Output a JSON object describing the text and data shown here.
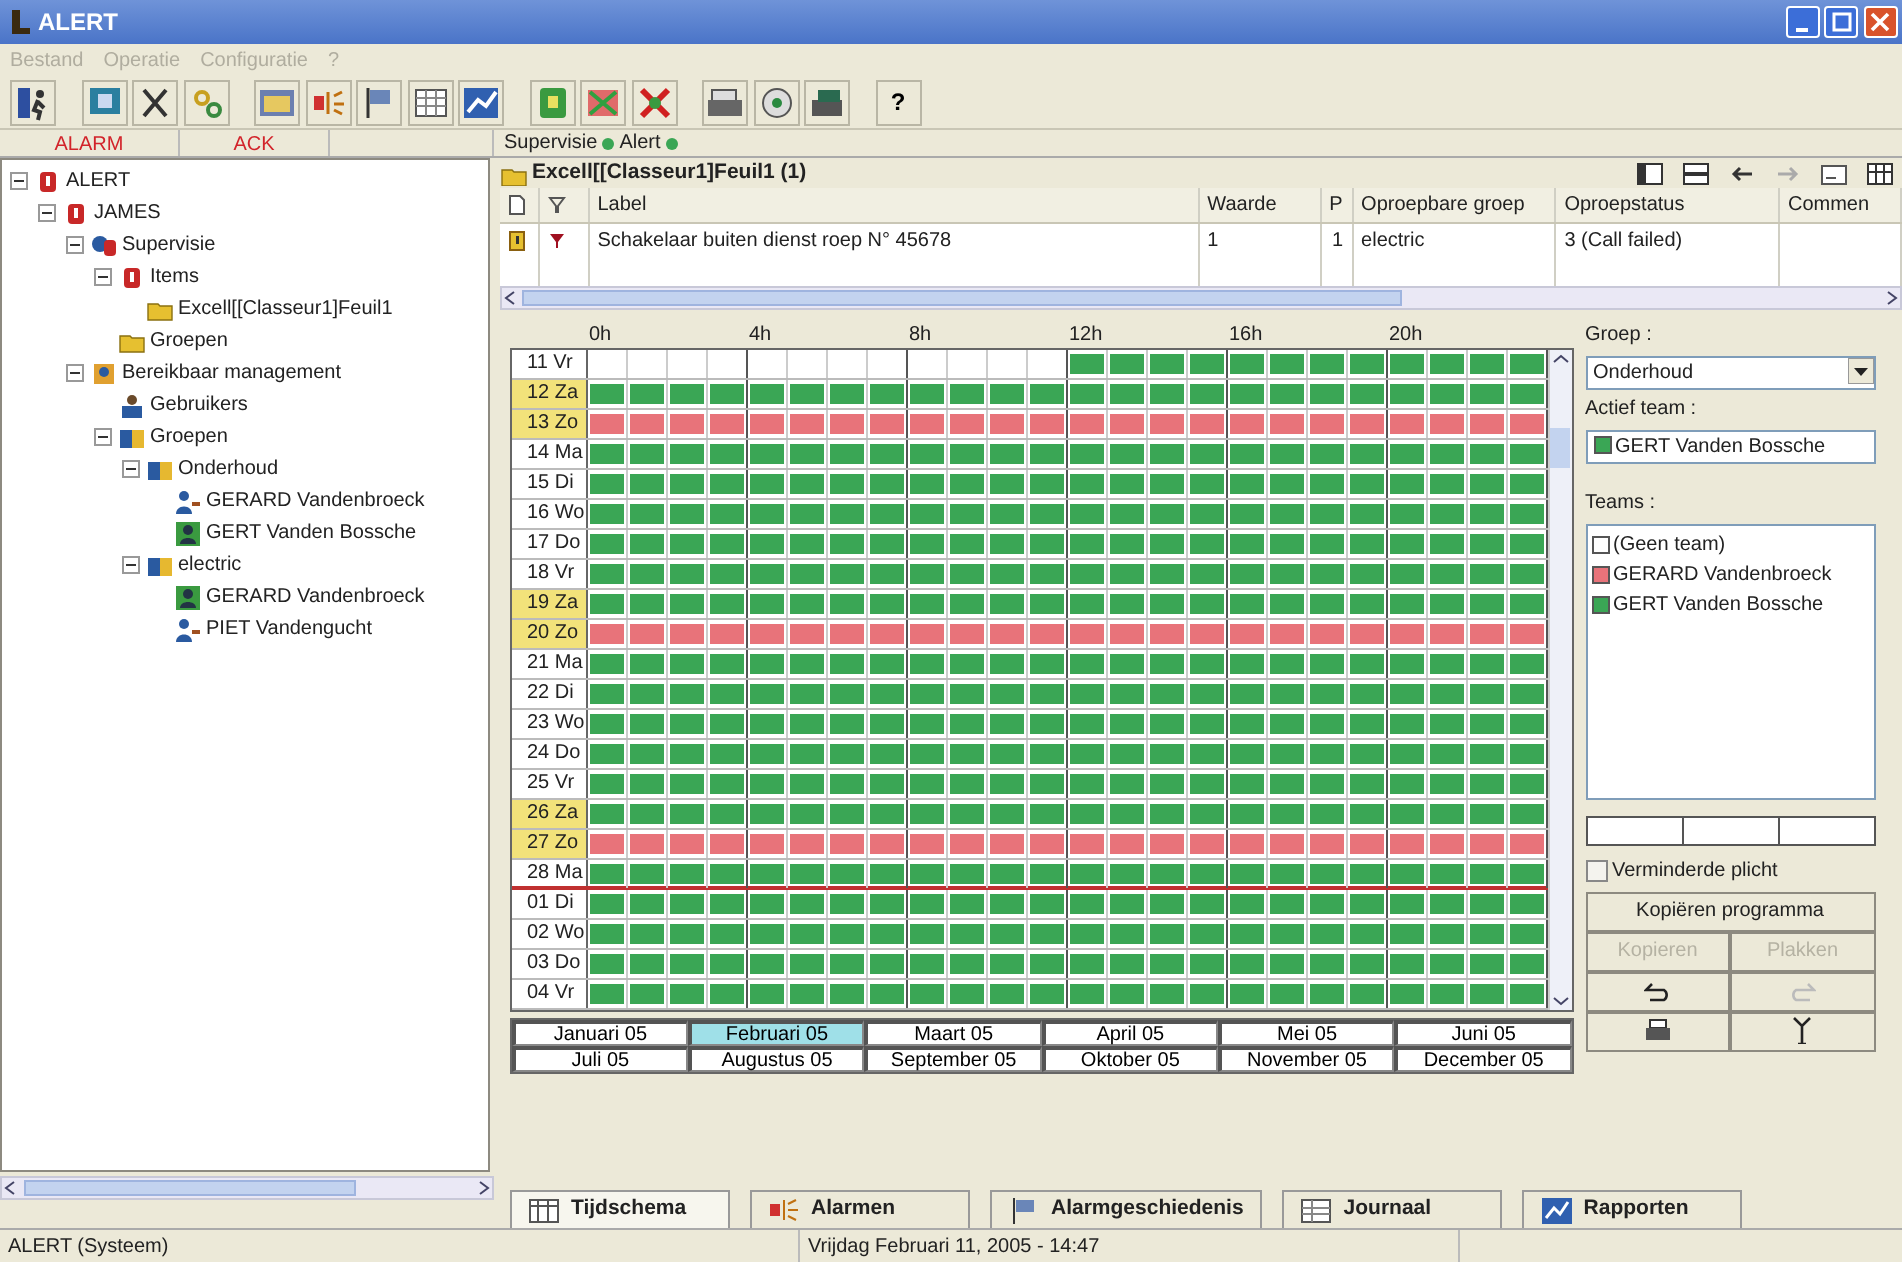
{
  "window": {
    "title": "ALERT"
  },
  "menu": [
    {
      "label": "Bestand"
    },
    {
      "label": "Operatie"
    },
    {
      "label": "Configuratie"
    },
    {
      "label": "?"
    }
  ],
  "toolbar": {
    "help_label": "?"
  },
  "alarm_bar": {
    "alarm": "ALARM",
    "ack": "ACK",
    "indicators": [
      {
        "label": "Supervisie",
        "color": "#3aa655"
      },
      {
        "label": "Alert",
        "color": "#3aa655"
      }
    ]
  },
  "tree": [
    {
      "label": "ALERT",
      "kind": "alarm",
      "expanded": true,
      "children": [
        {
          "label": "JAMES",
          "kind": "alarm",
          "expanded": true,
          "children": [
            {
              "label": "Supervisie",
              "kind": "supervision",
              "expanded": true,
              "children": [
                {
                  "label": "Items",
                  "kind": "alarm",
                  "expanded": true,
                  "children": [
                    {
                      "label": "Excell[[Classeur1]Feuil1",
                      "kind": "folder"
                    }
                  ]
                },
                {
                  "label": "Groepen",
                  "kind": "folder"
                }
              ]
            },
            {
              "label": "Bereikbaar management",
              "kind": "management",
              "expanded": true,
              "children": [
                {
                  "label": "Gebruikers",
                  "kind": "users"
                },
                {
                  "label": "Groepen",
                  "kind": "team",
                  "expanded": true,
                  "children": [
                    {
                      "label": "Onderhoud",
                      "kind": "team",
                      "expanded": true,
                      "children": [
                        {
                          "label": "GERARD Vandenbroeck",
                          "kind": "person"
                        },
                        {
                          "label": "GERT Vanden Bossche",
                          "kind": "member"
                        }
                      ]
                    },
                    {
                      "label": "electric",
                      "kind": "team",
                      "expanded": true,
                      "children": [
                        {
                          "label": "GERARD Vandenbroeck",
                          "kind": "member"
                        },
                        {
                          "label": "PIET Vandengucht",
                          "kind": "person"
                        }
                      ]
                    }
                  ]
                }
              ]
            }
          ]
        }
      ]
    }
  ],
  "items_panel": {
    "title": "Excell[[Classeur1]Feuil1 (1)",
    "columns": [
      "Label",
      "Waarde",
      "P",
      "Oproepbare groep",
      "Oproepstatus",
      "Commen"
    ],
    "rows": [
      {
        "cells": [
          "Schakelaar buiten dienst roep N° 45678",
          "1",
          "1",
          "electric",
          "3 (Call failed)",
          ""
        ]
      }
    ]
  },
  "schedule": {
    "hours": [
      "0h",
      "4h",
      "8h",
      "12h",
      "16h",
      "20h"
    ],
    "rows": [
      {
        "label": "11 Vr",
        "weekend": false,
        "morning_empty": true,
        "color": "#3aa655"
      },
      {
        "label": "12 Za",
        "weekend": true,
        "morning_empty": false,
        "color": "#3aa655"
      },
      {
        "label": "13 Zo",
        "weekend": true,
        "morning_empty": false,
        "color": "#e8737a"
      },
      {
        "label": "14 Ma",
        "weekend": false,
        "morning_empty": false,
        "color": "#3aa655"
      },
      {
        "label": "15 Di",
        "weekend": false,
        "morning_empty": false,
        "color": "#3aa655"
      },
      {
        "label": "16 Wo",
        "weekend": false,
        "morning_empty": false,
        "color": "#3aa655"
      },
      {
        "label": "17 Do",
        "weekend": false,
        "morning_empty": false,
        "color": "#3aa655"
      },
      {
        "label": "18 Vr",
        "weekend": false,
        "morning_empty": false,
        "color": "#3aa655"
      },
      {
        "label": "19 Za",
        "weekend": true,
        "morning_empty": false,
        "color": "#3aa655"
      },
      {
        "label": "20 Zo",
        "weekend": true,
        "morning_empty": false,
        "color": "#e8737a"
      },
      {
        "label": "21 Ma",
        "weekend": false,
        "morning_empty": false,
        "color": "#3aa655"
      },
      {
        "label": "22 Di",
        "weekend": false,
        "morning_empty": false,
        "color": "#3aa655"
      },
      {
        "label": "23 Wo",
        "weekend": false,
        "morning_empty": false,
        "color": "#3aa655"
      },
      {
        "label": "24 Do",
        "weekend": false,
        "morning_empty": false,
        "color": "#3aa655"
      },
      {
        "label": "25 Vr",
        "weekend": false,
        "morning_empty": false,
        "color": "#3aa655"
      },
      {
        "label": "26 Za",
        "weekend": true,
        "morning_empty": false,
        "color": "#3aa655"
      },
      {
        "label": "27 Zo",
        "weekend": true,
        "morning_empty": false,
        "color": "#e8737a"
      },
      {
        "label": "28 Ma",
        "weekend": false,
        "morning_empty": false,
        "color": "#3aa655"
      },
      {
        "label": "01 Di",
        "weekend": false,
        "morning_empty": false,
        "color": "#3aa655"
      },
      {
        "label": "02 Wo",
        "weekend": false,
        "morning_empty": false,
        "color": "#3aa655"
      },
      {
        "label": "03 Do",
        "weekend": false,
        "morning_empty": false,
        "color": "#3aa655"
      },
      {
        "label": "04 Vr",
        "weekend": false,
        "morning_empty": false,
        "color": "#3aa655"
      }
    ],
    "months": [
      {
        "label": "Januari 05",
        "selected": false
      },
      {
        "label": "Februari 05",
        "selected": true
      },
      {
        "label": "Maart 05",
        "selected": false
      },
      {
        "label": "April 05",
        "selected": false
      },
      {
        "label": "Mei 05",
        "selected": false
      },
      {
        "label": "Juni 05",
        "selected": false
      },
      {
        "label": "Juli 05",
        "selected": false
      },
      {
        "label": "Augustus 05",
        "selected": false
      },
      {
        "label": "September 05",
        "selected": false
      },
      {
        "label": "Oktober 05",
        "selected": false
      },
      {
        "label": "November 05",
        "selected": false
      },
      {
        "label": "December 05",
        "selected": false
      }
    ]
  },
  "side": {
    "group_label": "Groep :",
    "group_value": "Onderhoud",
    "active_label": "Actief team :",
    "active_team": {
      "label": "GERT Vanden Bossche",
      "color": "#3aa655"
    },
    "teams_label": "Teams :",
    "teams": [
      {
        "label": "(Geen team)",
        "color": "#ffffff"
      },
      {
        "label": "GERARD Vandenbroeck",
        "color": "#e8737a"
      },
      {
        "label": "GERT Vanden Bossche",
        "color": "#3aa655"
      }
    ],
    "reduced_duty": {
      "label": "Verminderde plicht",
      "checked": false
    },
    "copy_program": "Kopiëren programma",
    "copy": {
      "label": "Kopieren",
      "disabled": true
    },
    "paste": {
      "label": "Plakken",
      "disabled": true
    },
    "undo_disabled": false,
    "redo_disabled": true
  },
  "bottom_tabs": [
    {
      "label": "Tijdschema",
      "selected": true
    },
    {
      "label": "Alarmen",
      "selected": false
    },
    {
      "label": "Alarmgeschiedenis",
      "selected": false
    },
    {
      "label": "Journaal",
      "selected": false
    },
    {
      "label": "Rapporten",
      "selected": false
    }
  ],
  "status_bar": {
    "left": "ALERT (Systeem)",
    "center": "Vrijdag Februari 11, 2005 - 14:47"
  }
}
